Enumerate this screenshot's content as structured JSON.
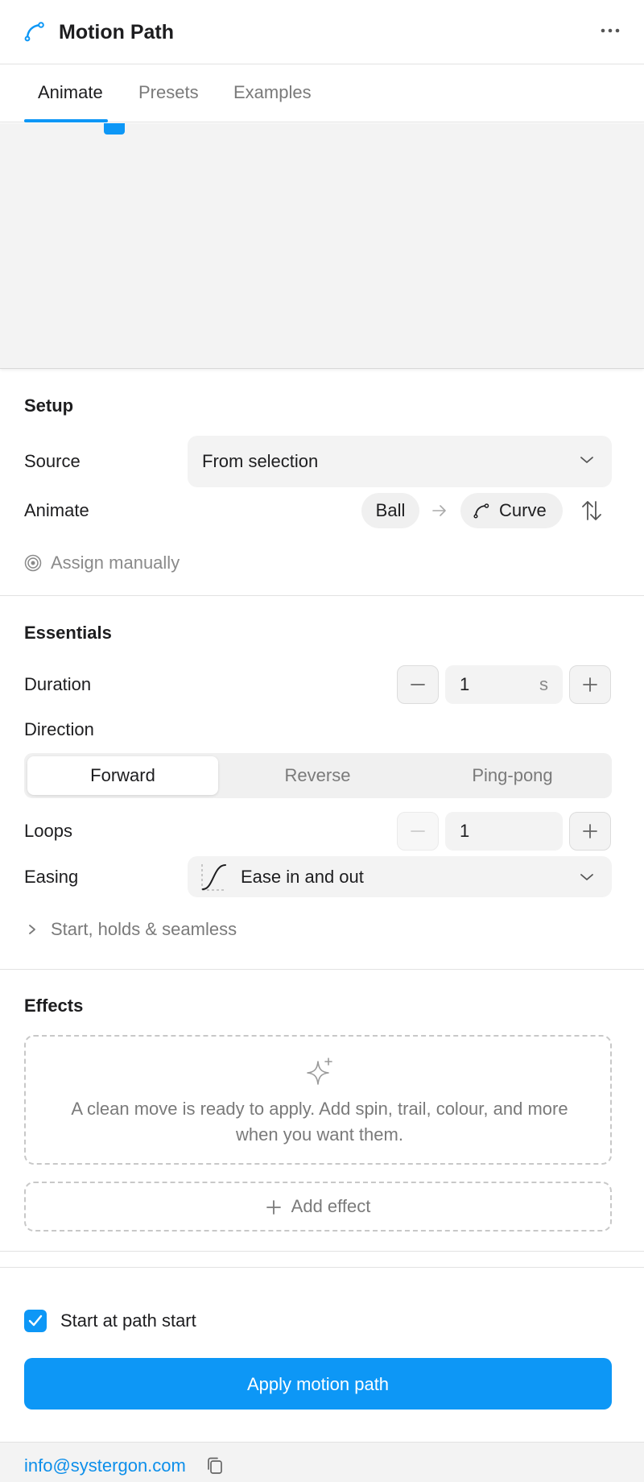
{
  "header": {
    "title": "Motion Path",
    "logo_icon": "motion-path-icon",
    "more_icon": "more-horizontal-icon"
  },
  "tabs": [
    {
      "label": "Animate",
      "active": true
    },
    {
      "label": "Presets",
      "active": false
    },
    {
      "label": "Examples",
      "active": false
    }
  ],
  "setup": {
    "title": "Setup",
    "source_label": "Source",
    "source_value": "From selection",
    "animate_label": "Animate",
    "animate_from": "Ball",
    "animate_to": "Curve",
    "assign_label": "Assign manually"
  },
  "essentials": {
    "title": "Essentials",
    "duration_label": "Duration",
    "duration_value": "1",
    "duration_unit": "s",
    "direction_label": "Direction",
    "direction_options": [
      "Forward",
      "Reverse",
      "Ping-pong"
    ],
    "direction_selected": "Forward",
    "loops_label": "Loops",
    "loops_value": "1",
    "easing_label": "Easing",
    "easing_value": "Ease in and out",
    "disclosure_label": "Start, holds & seamless"
  },
  "effects": {
    "title": "Effects",
    "empty_message": "A clean move is ready to apply. Add spin, trail, colour, and more when you want them.",
    "add_label": "Add effect"
  },
  "footer_actions": {
    "checkbox_label": "Start at path start",
    "checkbox_checked": true,
    "apply_label": "Apply motion path"
  },
  "footer": {
    "email": "info@systergon.com"
  },
  "colors": {
    "accent": "#0d97f6",
    "panel_bg": "#f3f3f3",
    "text": "#1d1d1f",
    "muted": "#7a7a7a"
  }
}
